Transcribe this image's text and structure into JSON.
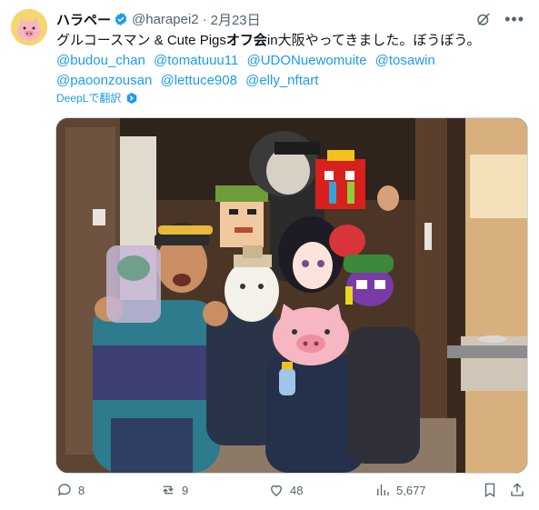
{
  "tweet": {
    "display_name": "ハラペー",
    "handle": "@harapei2",
    "separator": "·",
    "date": "2月23日",
    "text": "グルコースマン & Cute Pigsオフ会in大阪やってきました。ぼうぼう。",
    "text_plain_1": "グルコースマン & Cute Pigs",
    "text_bold": "オフ会",
    "text_plain_2": "in大阪やってきました。ぼうぼう。",
    "mentions": [
      "@budou_chan",
      "@tomatuuu11",
      "@UDONuewomuite",
      "@tosawin",
      "@paoonzousan",
      "@lettuce908",
      "@elly_nftart"
    ],
    "translate_label": "DeepLで翻訳"
  },
  "actions": {
    "replies": "8",
    "reposts": "9",
    "likes": "48",
    "views": "5,677"
  },
  "colors": {
    "link": "#1d9bf0",
    "muted": "#536471",
    "verified": "#1d9bf0"
  },
  "icons": {
    "verified": "verified-badge-icon",
    "grok": "grok-icon",
    "more": "more-icon",
    "translate": "translate-icon",
    "reply": "reply-icon",
    "repost": "repost-icon",
    "like": "heart-icon",
    "views": "views-icon",
    "bookmark": "bookmark-icon",
    "share": "share-icon"
  }
}
